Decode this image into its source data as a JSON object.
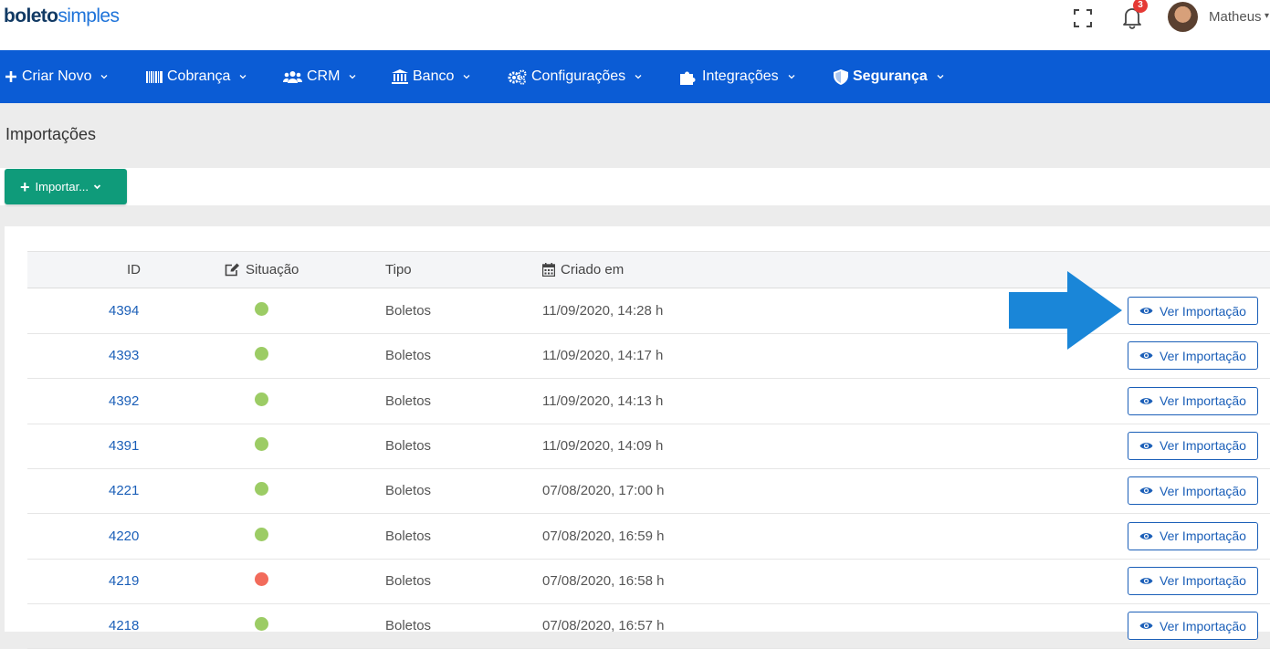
{
  "header": {
    "logo_part1": "boleto",
    "logo_part2": "simples",
    "notification_count": "3",
    "username": "Matheus"
  },
  "nav": {
    "items": [
      {
        "label": "Criar Novo",
        "icon": "plus-icon"
      },
      {
        "label": "Cobrança",
        "icon": "barcode-icon"
      },
      {
        "label": "CRM",
        "icon": "users-icon"
      },
      {
        "label": "Banco",
        "icon": "bank-icon"
      },
      {
        "label": "Configurações",
        "icon": "gears-icon"
      },
      {
        "label": "Integrações",
        "icon": "puzzle-icon"
      },
      {
        "label": "Segurança",
        "icon": "shield-icon"
      }
    ]
  },
  "page": {
    "title": "Importações",
    "import_button_label": "Importar..."
  },
  "table": {
    "columns": {
      "id": "ID",
      "status": "Situação",
      "type": "Tipo",
      "created": "Criado em"
    },
    "rows": [
      {
        "id": "4394",
        "status": "success",
        "type": "Boletos",
        "created": "11/09/2020, 14:28 h",
        "action": "Ver Importação"
      },
      {
        "id": "4393",
        "status": "success",
        "type": "Boletos",
        "created": "11/09/2020, 14:17 h",
        "action": "Ver Importação"
      },
      {
        "id": "4392",
        "status": "success",
        "type": "Boletos",
        "created": "11/09/2020, 14:13 h",
        "action": "Ver Importação"
      },
      {
        "id": "4391",
        "status": "success",
        "type": "Boletos",
        "created": "11/09/2020, 14:09 h",
        "action": "Ver Importação"
      },
      {
        "id": "4221",
        "status": "success",
        "type": "Boletos",
        "created": "07/08/2020, 17:00 h",
        "action": "Ver Importação"
      },
      {
        "id": "4220",
        "status": "success",
        "type": "Boletos",
        "created": "07/08/2020, 16:59 h",
        "action": "Ver Importação"
      },
      {
        "id": "4219",
        "status": "error",
        "type": "Boletos",
        "created": "07/08/2020, 16:58 h",
        "action": "Ver Importação"
      },
      {
        "id": "4218",
        "status": "success",
        "type": "Boletos",
        "created": "07/08/2020, 16:57 h",
        "action": "Ver Importação"
      }
    ]
  },
  "colors": {
    "brand_dark": "#123a64",
    "brand_blue": "#1e73d9",
    "nav_bg": "#0b5cd5",
    "import_button": "#0f9b7a",
    "status_success": "#9ccc65",
    "status_error": "#f26b5b",
    "link": "#1b5fb8",
    "annotation_arrow": "#1a86d8"
  }
}
